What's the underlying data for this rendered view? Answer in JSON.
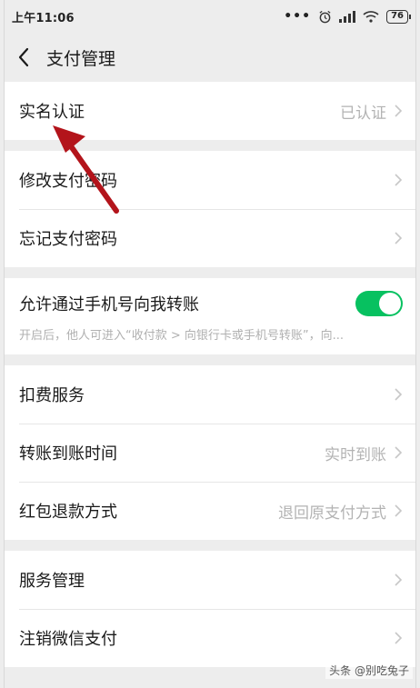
{
  "status_bar": {
    "time": "上午11:06",
    "dots": "•••",
    "battery": "76"
  },
  "header": {
    "title": "支付管理"
  },
  "groups": {
    "g1": {
      "items": [
        {
          "label": "实名认证",
          "value": "已认证"
        }
      ]
    },
    "g2": {
      "items": [
        {
          "label": "修改支付密码",
          "value": ""
        },
        {
          "label": "忘记支付密码",
          "value": ""
        }
      ]
    },
    "g3": {
      "toggle": {
        "label": "允许通过手机号向我转账",
        "on": true,
        "description": "开启后，他人可进入“收付款 > 向银行卡或手机号转账”，向..."
      }
    },
    "g4": {
      "items": [
        {
          "label": "扣费服务",
          "value": ""
        },
        {
          "label": "转账到账时间",
          "value": "实时到账"
        },
        {
          "label": "红包退款方式",
          "value": "退回原支付方式"
        }
      ]
    },
    "g5": {
      "items": [
        {
          "label": "服务管理",
          "value": ""
        },
        {
          "label": "注销微信支付",
          "value": ""
        }
      ]
    }
  },
  "watermark": "头条 @别吃兔子",
  "colors": {
    "toggle_on": "#07c160",
    "annotation_arrow": "#b3141b"
  }
}
